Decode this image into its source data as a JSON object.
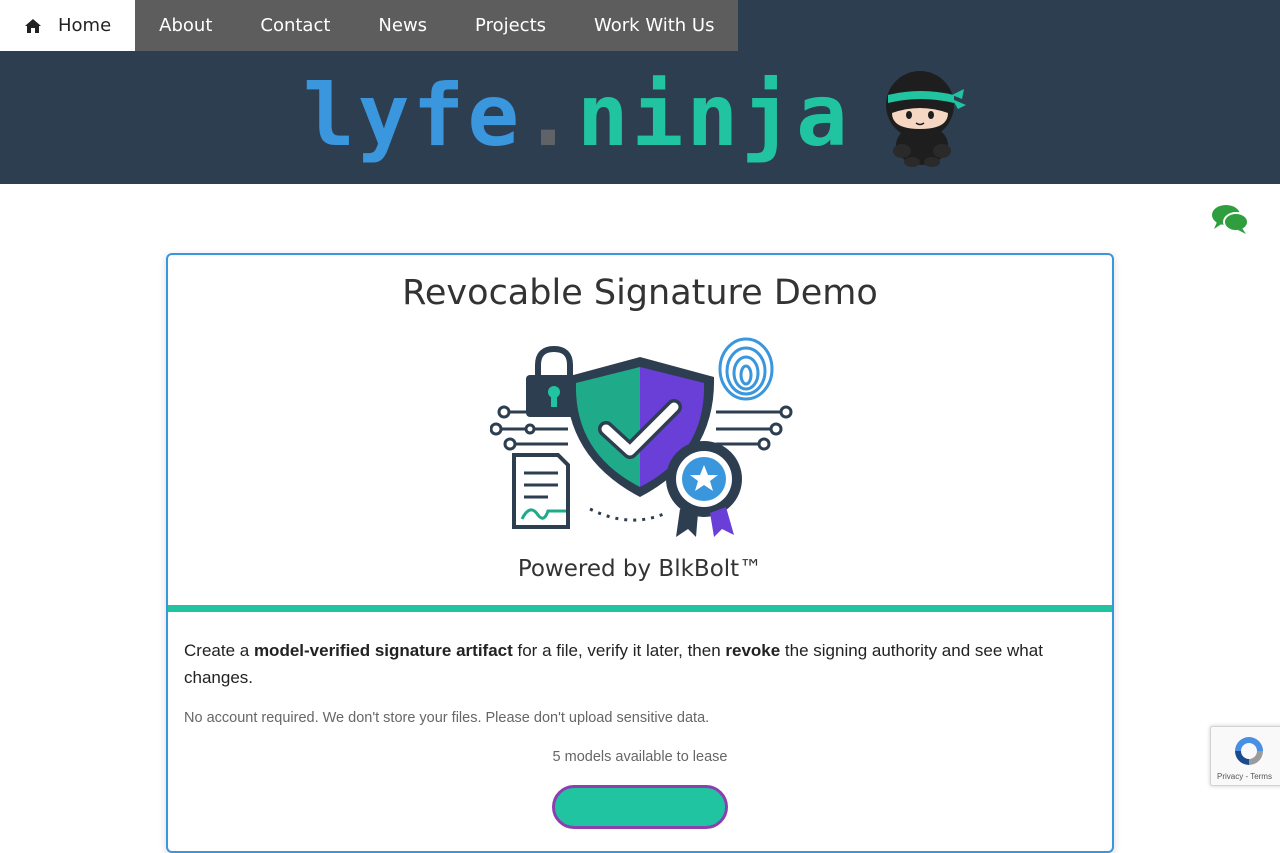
{
  "nav": {
    "items": [
      {
        "label": "Home",
        "active": true,
        "icon": "home-icon"
      },
      {
        "label": "About"
      },
      {
        "label": "Contact"
      },
      {
        "label": "News"
      },
      {
        "label": "Projects"
      },
      {
        "label": "Work With Us"
      }
    ]
  },
  "header": {
    "logo_part1": "lyfe",
    "logo_dot": ".",
    "logo_part2": "ninja",
    "mascot_icon": "ninja-mascot-icon"
  },
  "chat": {
    "icon": "chat-bubbles-icon"
  },
  "card": {
    "title": "Revocable Signature Demo",
    "hero_icon": "security-shield-illustration",
    "powered": "Powered by BlkBolt™",
    "desc_1": "Create a ",
    "desc_b1": "model-verified signature artifact",
    "desc_2": " for a file, verify it later, then ",
    "desc_b2": "revoke",
    "desc_3": " the signing authority and see what changes.",
    "note": "No account required. We don't store your files. Please don't upload sensitive data.",
    "models": "5 models available to lease"
  },
  "recaptcha": {
    "links": "Privacy - Terms"
  },
  "colors": {
    "nav_bg": "#2d3e50",
    "nav_group": "#5d5d5d",
    "accent_blue": "#3a96dd",
    "accent_teal": "#20c4a1",
    "accent_purple": "#8c3fae"
  }
}
